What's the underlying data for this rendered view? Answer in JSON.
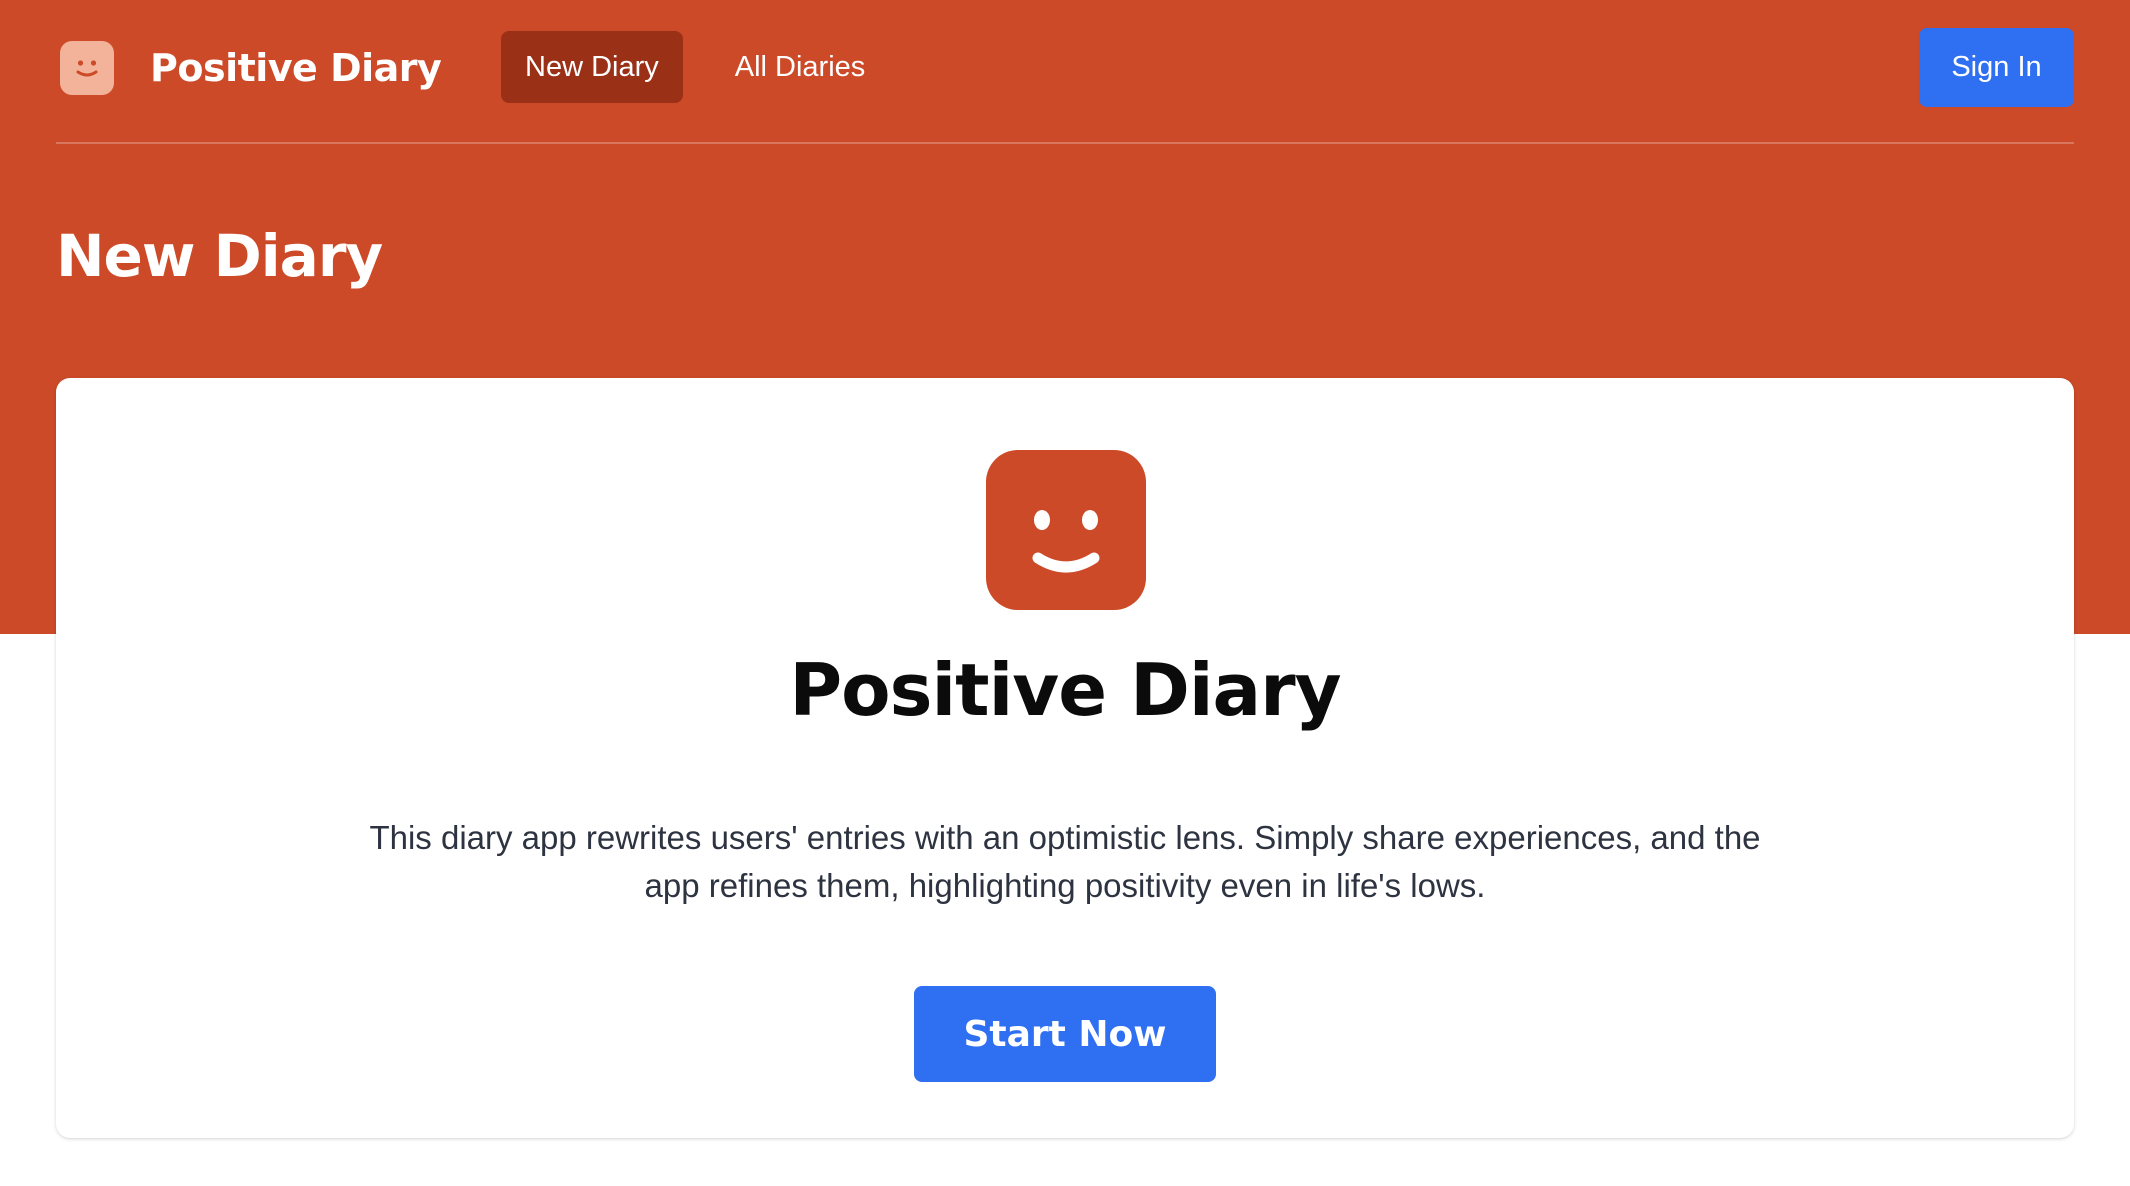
{
  "app": {
    "name": "Positive Diary",
    "logo_icon": "smiley-face-icon"
  },
  "nav": {
    "items": [
      {
        "label": "New Diary",
        "active": true
      },
      {
        "label": "All Diaries",
        "active": false
      }
    ]
  },
  "auth": {
    "sign_in_label": "Sign In"
  },
  "page": {
    "title": "New Diary"
  },
  "card": {
    "icon": "smiley-face-icon",
    "title": "Positive Diary",
    "description": "This diary app rewrites users' entries with an optimistic lens. Simply share experiences, and the app refines them, highlighting positivity even in life's lows.",
    "cta_label": "Start Now"
  },
  "colors": {
    "brand": "#cc4a28",
    "nav_active": "#9a3117",
    "logo_small_bg": "#f3b39b",
    "primary_button": "#2f6ff1"
  }
}
